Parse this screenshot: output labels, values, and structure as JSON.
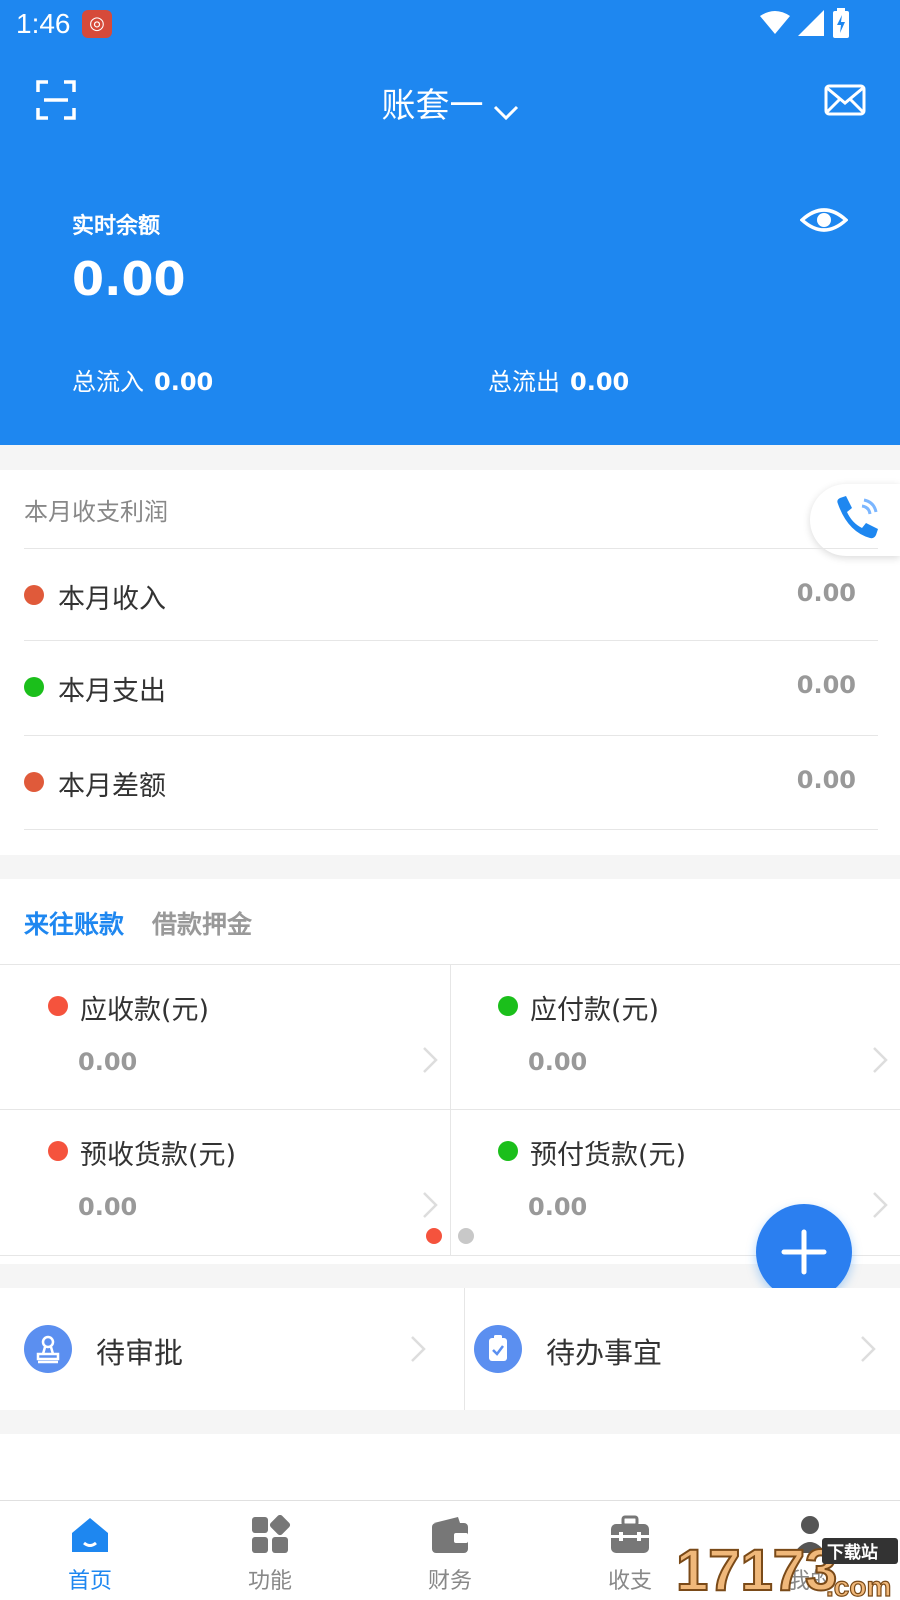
{
  "status_bar": {
    "time": "1:46"
  },
  "header": {
    "title": "账套一",
    "balance_label": "实时余额",
    "balance_value": "0.00",
    "inflow_label": "总流入",
    "inflow_value": "0.00",
    "outflow_label": "总流出",
    "outflow_value": "0.00"
  },
  "month_card": {
    "title": "本月收支利润",
    "rows": [
      {
        "label": "本月收入",
        "value": "0.00",
        "color": "#e05a3a"
      },
      {
        "label": "本月支出",
        "value": "0.00",
        "color": "#1bbf1b"
      },
      {
        "label": "本月差额",
        "value": "0.00",
        "color": "#e05a3a"
      }
    ]
  },
  "receivables_card": {
    "tabs": [
      {
        "label": "来往账款",
        "active": true
      },
      {
        "label": "借款押金",
        "active": false
      }
    ],
    "cells": [
      {
        "label": "应收款(元)",
        "value": "0.00",
        "color": "#f5533d"
      },
      {
        "label": "应付款(元)",
        "value": "0.00",
        "color": "#1bbf1b"
      },
      {
        "label": "预收货款(元)",
        "value": "0.00",
        "color": "#f5533d"
      },
      {
        "label": "预付货款(元)",
        "value": "0.00",
        "color": "#1bbf1b"
      }
    ],
    "pager": {
      "active_page": 1,
      "pages": 2
    }
  },
  "tasks": [
    {
      "label": "待审批",
      "icon": "stamp-icon"
    },
    {
      "label": "待办事宜",
      "icon": "clipboard-check-icon"
    }
  ],
  "bottom_nav": [
    {
      "label": "首页",
      "icon": "home-icon",
      "active": true
    },
    {
      "label": "功能",
      "icon": "grid-icon",
      "active": false
    },
    {
      "label": "财务",
      "icon": "wallet-icon",
      "active": false
    },
    {
      "label": "收支",
      "icon": "briefcase-icon",
      "active": false
    },
    {
      "label": "我的",
      "icon": "user-icon",
      "active": false
    }
  ],
  "watermark": {
    "text": "下载站",
    "digits": "17173",
    "domain": ".com"
  },
  "colors": {
    "primary": "#1e87f0",
    "income_red": "#e05a3a",
    "expense_green": "#1bbf1b"
  }
}
